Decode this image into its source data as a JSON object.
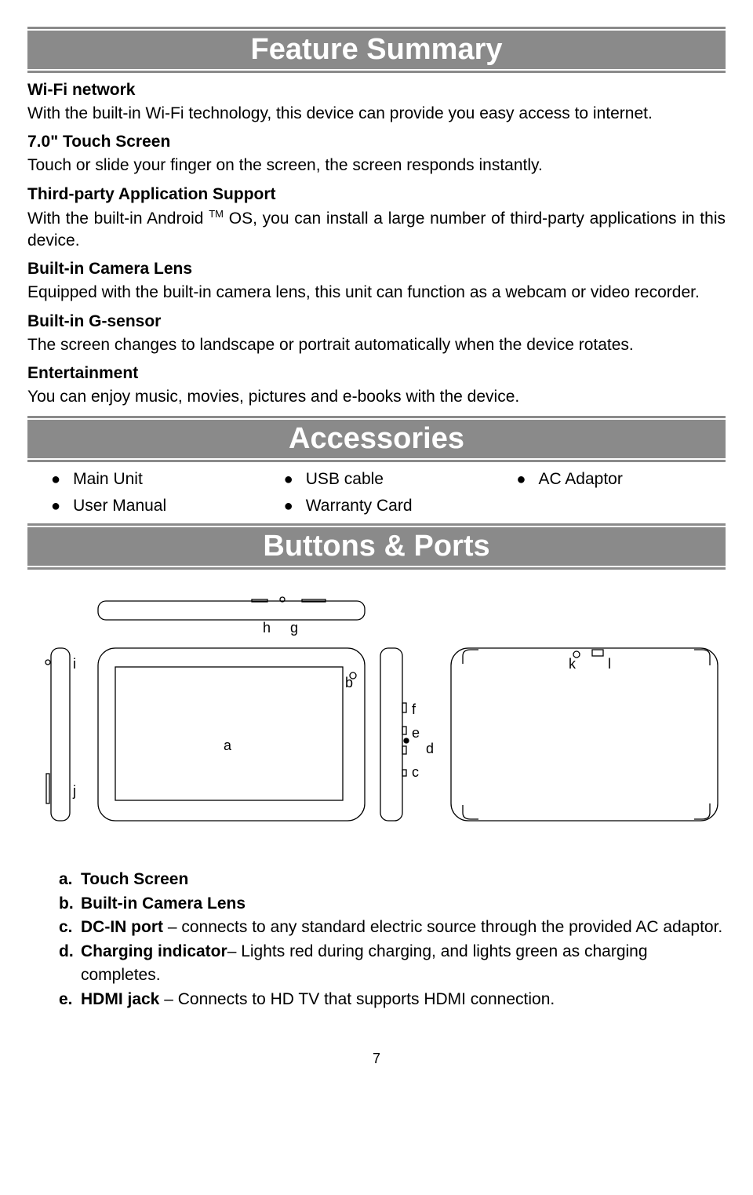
{
  "headings": {
    "feature_summary": "Feature Summary",
    "accessories": "Accessories",
    "buttons_ports": "Buttons & Ports"
  },
  "features": {
    "wifi": {
      "title": "Wi-Fi network",
      "body": "With the built-in Wi-Fi technology, this device can provide you easy access to internet."
    },
    "touch": {
      "title": "7.0\" Touch Screen",
      "body": "Touch or slide your finger on the screen, the screen responds instantly."
    },
    "third_party": {
      "title": "Third-party Application Support",
      "body_pre": "With the built-in Android",
      "tm": "TM",
      "body_post": " OS, you can install a large number of third-party applications in this device."
    },
    "camera": {
      "title": "Built-in Camera Lens",
      "body": "Equipped with the built-in camera lens, this unit can function as a webcam or video recorder."
    },
    "gsensor": {
      "title": "Built-in G-sensor",
      "body": "The screen changes to landscape or portrait automatically when the device rotates."
    },
    "entertainment": {
      "title": "Entertainment",
      "body": "You can enjoy music, movies, pictures and e-books with the device."
    }
  },
  "accessories": {
    "r1c1": "Main Unit",
    "r1c2": "USB cable",
    "r1c3": "AC Adaptor",
    "r2c1": "User Manual",
    "r2c2": "Warranty Card"
  },
  "diagram_labels": {
    "a": "a",
    "b": "b",
    "c": "c",
    "d": "d",
    "e": "e",
    "f": "f",
    "g": "g",
    "h": "h",
    "i": "i",
    "j": "j",
    "k": "k",
    "l": "l"
  },
  "ports": {
    "a": {
      "letter": "a.",
      "label": "Touch Screen",
      "desc": ""
    },
    "b": {
      "letter": "b.",
      "label": "Built-in Camera Lens",
      "desc": ""
    },
    "c": {
      "letter": "c.",
      "label": "DC-IN port",
      "desc": " – connects to any standard electric source through the provided AC adaptor."
    },
    "d": {
      "letter": "d.",
      "label": "Charging indicator",
      "desc": "– Lights red during charging, and lights green as charging completes."
    },
    "e": {
      "letter": "e.",
      "label": "HDMI jack",
      "desc": " – Connects to HD TV that supports HDMI connection."
    }
  },
  "page_number": "7"
}
